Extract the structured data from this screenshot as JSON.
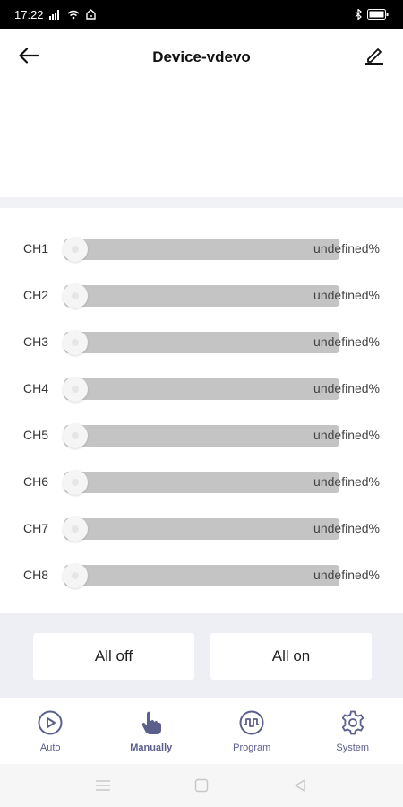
{
  "status_bar": {
    "time": "17:22",
    "icons": [
      "signal-icon",
      "wifi-icon",
      "data-icon",
      "bluetooth-icon",
      "battery-icon"
    ]
  },
  "header": {
    "title": "Device-vdevo",
    "back_icon": "back-arrow-icon",
    "edit_icon": "edit-pencil-icon"
  },
  "channels": [
    {
      "label": "CH1",
      "value": "undefined%"
    },
    {
      "label": "CH2",
      "value": "undefined%"
    },
    {
      "label": "CH3",
      "value": "undefined%"
    },
    {
      "label": "CH4",
      "value": "undefined%"
    },
    {
      "label": "CH5",
      "value": "undefined%"
    },
    {
      "label": "CH6",
      "value": "undefined%"
    },
    {
      "label": "CH7",
      "value": "undefined%"
    },
    {
      "label": "CH8",
      "value": "undefined%"
    }
  ],
  "actions": {
    "all_off": "All off",
    "all_on": "All on"
  },
  "bottom_nav": {
    "items": [
      {
        "label": "Auto",
        "icon": "play-circle-icon"
      },
      {
        "label": "Manually",
        "icon": "hand-pointer-icon",
        "active": true
      },
      {
        "label": "Program",
        "icon": "waveform-icon"
      },
      {
        "label": "System",
        "icon": "gear-icon"
      }
    ]
  },
  "colors": {
    "accent": "#5b5f8c",
    "track": "#c4c4c4",
    "band": "#f1f2f6",
    "button_area": "#eeeff4"
  }
}
